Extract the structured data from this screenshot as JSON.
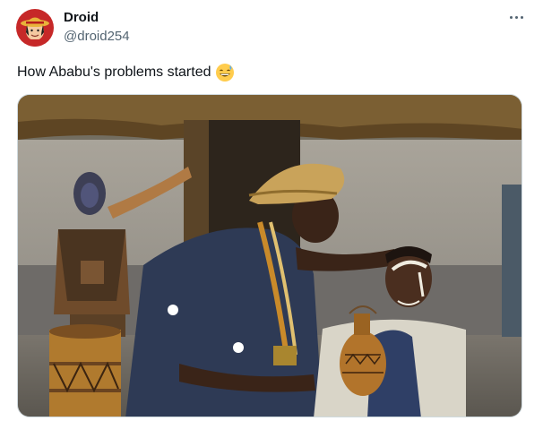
{
  "tweet": {
    "author_name": "Droid",
    "author_handle": "@droid254",
    "text": "How Ababu's problems started",
    "emoji": "grinning-face-with-sweat",
    "avatar_icon": "anime-character-straw-hat-avatar",
    "media_description_icon": "photo"
  },
  "colors": {
    "text_primary": "#0f1419",
    "text_secondary": "#536471",
    "border": "#cfd9de"
  }
}
